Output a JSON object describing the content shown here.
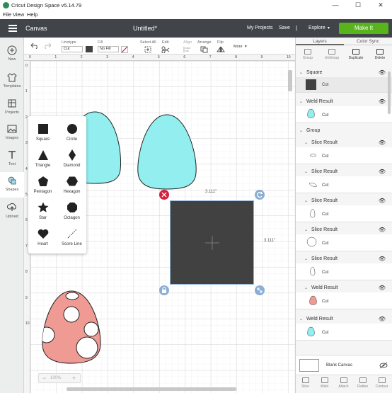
{
  "window": {
    "title": "Cricut Design Space  v5.14.79",
    "controls": [
      "—",
      "☐",
      "✕"
    ]
  },
  "menu": [
    "File",
    "View",
    "Help"
  ],
  "header": {
    "canvas_label": "Canvas",
    "doc_title": "Untitled*",
    "my_projects": "My Projects",
    "save": "Save",
    "separator": "|",
    "explore": "Explore",
    "make_it": "Make It",
    "make_it_color": "#57b41b"
  },
  "toolbar": {
    "undo_icon": "undo-icon",
    "redo_icon": "redo-icon",
    "linetype_label": "Linetype",
    "linetype_value": "Cut",
    "fill_label": "Fill",
    "fill_value": "No Fill",
    "select_all": "Select All",
    "edit": "Edit",
    "align": "Align",
    "arrange": "Arrange",
    "flip": "Flip",
    "more": "More"
  },
  "sidebar": [
    {
      "label": "New",
      "icon": "plus-icon"
    },
    {
      "label": "Templates",
      "icon": "shirt-icon"
    },
    {
      "label": "Projects",
      "icon": "projects-icon"
    },
    {
      "label": "Images",
      "icon": "image-icon"
    },
    {
      "label": "Text",
      "icon": "text-icon"
    },
    {
      "label": "Shapes",
      "icon": "shapes-icon"
    },
    {
      "label": "Upload",
      "icon": "upload-icon"
    }
  ],
  "rulers": {
    "top": [
      "0",
      "1",
      "2",
      "3",
      "4",
      "5",
      "6",
      "7",
      "8",
      "9",
      "10",
      "11",
      "12"
    ],
    "left": [
      "0",
      "1",
      "2",
      "3",
      "4",
      "5",
      "6",
      "7",
      "8",
      "9",
      "10"
    ]
  },
  "shapes_panel": [
    {
      "label": "Square"
    },
    {
      "label": "Circle"
    },
    {
      "label": "Triangle"
    },
    {
      "label": "Diamond"
    },
    {
      "label": "Pentagon"
    },
    {
      "label": "Hexagon"
    },
    {
      "label": "Star"
    },
    {
      "label": "Octagon"
    },
    {
      "label": "Heart"
    },
    {
      "label": "Score Line"
    }
  ],
  "canvas": {
    "width_dim": "3.111\"",
    "height_dim": "3.111\"",
    "zoom": "100%",
    "square_color": "#414141",
    "egg_color": "#93eef0",
    "pink_egg_color": "#f09a94"
  },
  "layers_panel": {
    "tabs": [
      "Layers",
      "Color Sync"
    ],
    "actions": [
      "Group",
      "UnGroup",
      "Duplicate",
      "Delete"
    ],
    "items": [
      {
        "title": "Square",
        "sub": "Cut",
        "thumb": "square"
      },
      {
        "title": "Weld Result",
        "sub": "Cut",
        "thumb": "cyan-egg"
      },
      {
        "title": "Group"
      },
      {
        "title": "Slice Result",
        "sub": "Cut",
        "thumb": "slice-1"
      },
      {
        "title": "Slice Result",
        "sub": "Cut",
        "thumb": "slice-2"
      },
      {
        "title": "Slice Result",
        "sub": "Cut",
        "thumb": "slice-3"
      },
      {
        "title": "Slice Result",
        "sub": "Cut",
        "thumb": "slice-4"
      },
      {
        "title": "Slice Result",
        "sub": "Cut",
        "thumb": "slice-5"
      },
      {
        "title": "Weld Result",
        "sub": "Cut",
        "thumb": "pink-egg"
      },
      {
        "title": "Weld Result",
        "sub": "Cut",
        "thumb": "cyan-egg-2"
      }
    ],
    "blank_canvas": "Blank Canvas",
    "bottom_actions": [
      "Slice",
      "Weld",
      "Attach",
      "Flatten",
      "Contour"
    ]
  }
}
